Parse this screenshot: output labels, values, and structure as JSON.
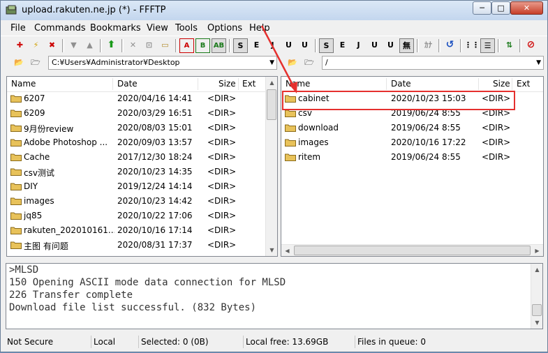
{
  "window": {
    "title": "upload.rakuten.ne.jp (*) - FFFTP",
    "minimize": "─",
    "maximize": "□",
    "close": "✕"
  },
  "menu": [
    "File",
    "Commands",
    "Bookmarks",
    "View",
    "Tools",
    "Options",
    "Help"
  ],
  "toolbar": {
    "transfer_modes_left": [
      "S",
      "E",
      "J",
      "U",
      "U"
    ],
    "transfer_modes_right": [
      "S",
      "E",
      "J",
      "U",
      "U"
    ],
    "icons": [
      "connect-icon",
      "quick-connect-icon",
      "disconnect-icon",
      "download-icon",
      "upload-icon",
      "mirror-upload-icon",
      "delete-icon",
      "rename-icon",
      "mkdir-icon",
      "ascii-mode-icon",
      "binary-mode-icon",
      "auto-mode-icon",
      "no-conversion-icon",
      "kana-icon",
      "refresh-icon",
      "list-view-icon",
      "detail-view-icon",
      "sync-icon",
      "stop-icon"
    ]
  },
  "local": {
    "path": "C:¥Users¥Administrator¥Desktop",
    "columns": {
      "name": "Name",
      "date": "Date",
      "size": "Size",
      "ext": "Ext"
    },
    "files": [
      {
        "name": "6207",
        "date": "2020/04/16 14:41",
        "size": "<DIR>"
      },
      {
        "name": "6209",
        "date": "2020/03/29 16:51",
        "size": "<DIR>"
      },
      {
        "name": "9月份review",
        "date": "2020/08/03 15:01",
        "size": "<DIR>"
      },
      {
        "name": "Adobe Photoshop ...",
        "date": "2020/09/03 13:57",
        "size": "<DIR>"
      },
      {
        "name": "Cache",
        "date": "2017/12/30 18:24",
        "size": "<DIR>"
      },
      {
        "name": "csv测试",
        "date": "2020/10/23 14:35",
        "size": "<DIR>"
      },
      {
        "name": "DIY",
        "date": "2019/12/24 14:14",
        "size": "<DIR>"
      },
      {
        "name": "images",
        "date": "2020/10/23 14:42",
        "size": "<DIR>"
      },
      {
        "name": "jq85",
        "date": "2020/10/22 17:06",
        "size": "<DIR>"
      },
      {
        "name": "rakuten_202010161...",
        "date": "2020/10/16 17:14",
        "size": "<DIR>"
      },
      {
        "name": "主图 有问题",
        "date": "2020/08/31 17:37",
        "size": "<DIR>"
      }
    ]
  },
  "remote": {
    "path": "/",
    "columns": {
      "name": "Name",
      "date": "Date",
      "size": "Size",
      "ext": "Ext"
    },
    "files": [
      {
        "name": "cabinet",
        "date": "2020/10/23 15:03",
        "size": "<DIR>"
      },
      {
        "name": "csv",
        "date": "2019/06/24  8:55",
        "size": "<DIR>"
      },
      {
        "name": "download",
        "date": "2019/06/24  8:55",
        "size": "<DIR>"
      },
      {
        "name": "images",
        "date": "2020/10/16 17:22",
        "size": "<DIR>"
      },
      {
        "name": "ritem",
        "date": "2019/06/24  8:55",
        "size": "<DIR>"
      }
    ]
  },
  "log": [
    ">MLSD",
    "150 Opening ASCII mode data connection for MLSD",
    "226 Transfer complete",
    "Download file list successful. (832 Bytes)"
  ],
  "status": {
    "security": "Not Secure",
    "side": "Local",
    "selected": "Selected: 0 (0B)",
    "free": "Local free: 13.69GB",
    "queue": "Files in queue: 0"
  },
  "colors": {
    "highlight": "#e5302e",
    "folder": "#e8c25a"
  }
}
